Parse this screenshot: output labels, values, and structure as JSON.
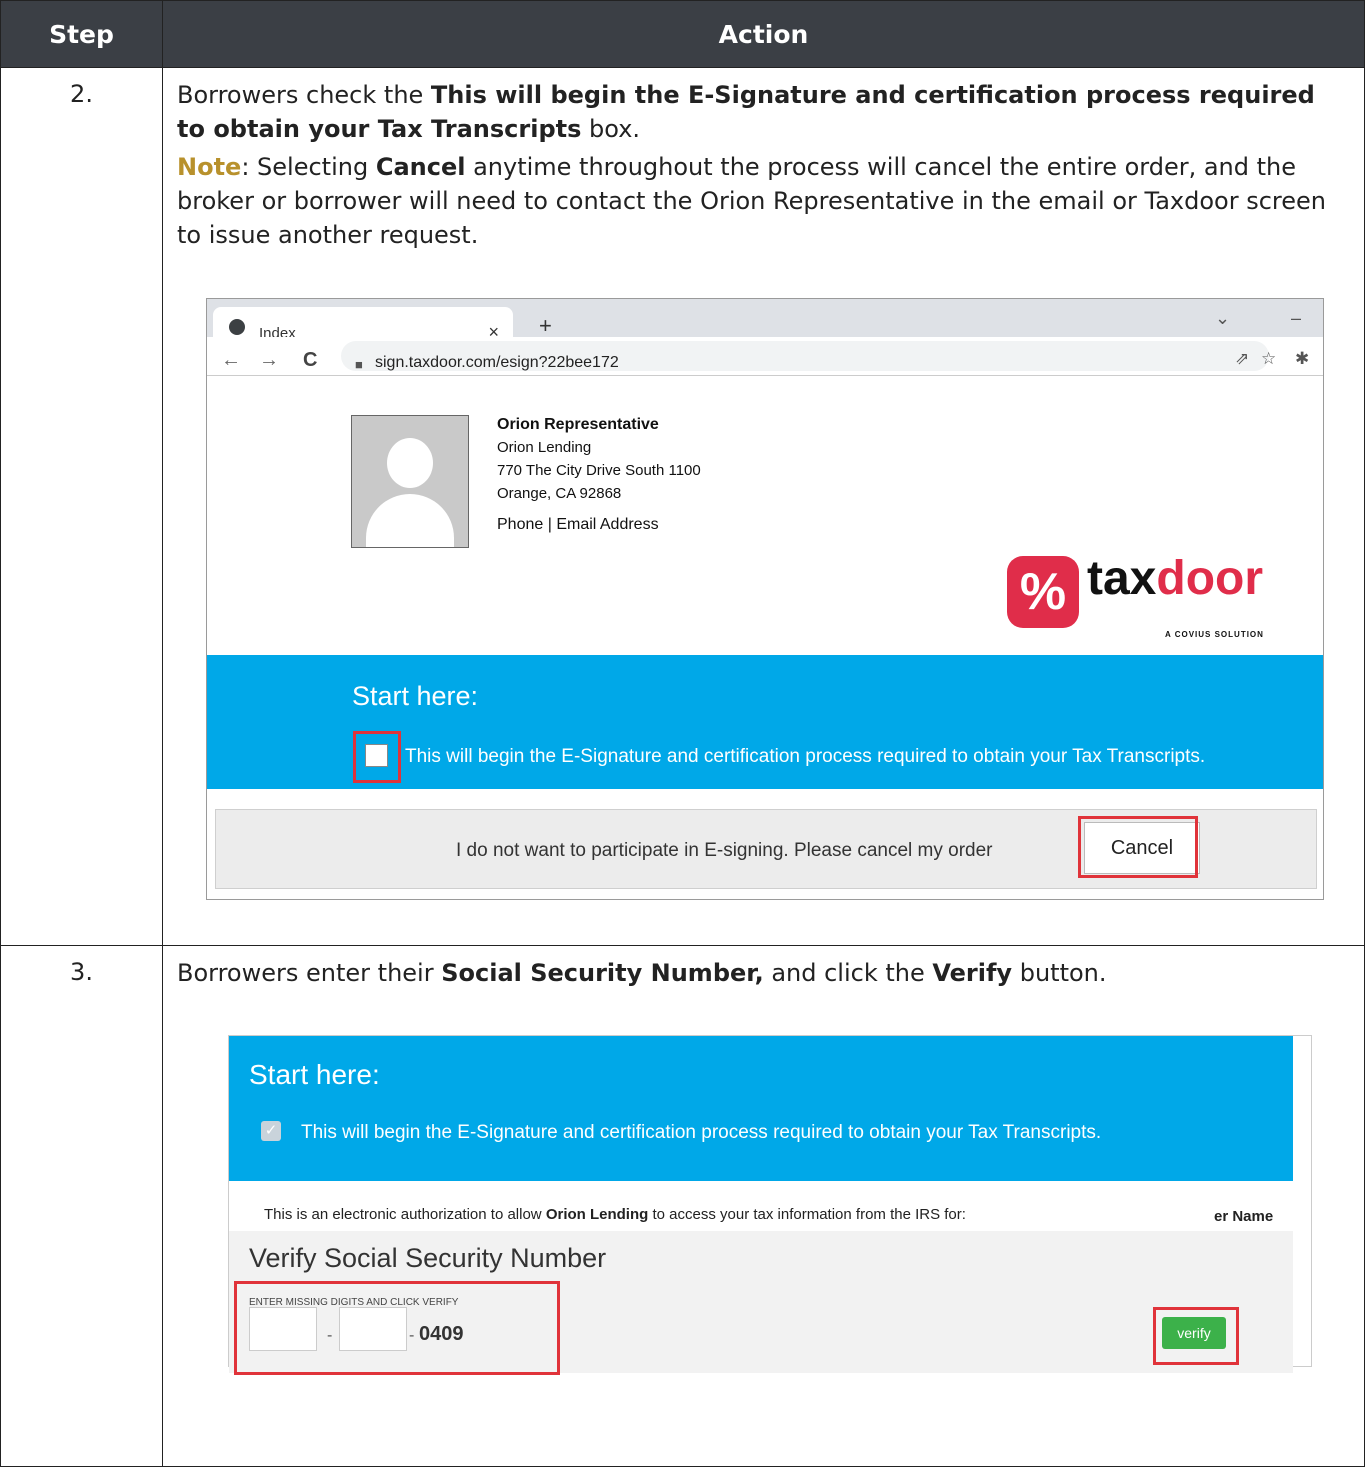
{
  "table": {
    "headers": [
      "Step",
      "Action"
    ]
  },
  "step2": {
    "number": "2.",
    "line_pre": "Borrowers check the ",
    "line_bold": "This will begin the E-Signature and certification process required to obtain your Tax Transcripts",
    "line_post": " box.",
    "note_label": "Note",
    "note_pre": ": Selecting ",
    "note_bold": "Cancel",
    "note_post": " anytime throughout the process will cancel the entire order, and the broker or borrower will need to contact the Orion Representative in the email or Taxdoor screen to issue another request.",
    "browser": {
      "tab_title": "Index",
      "tab_close": "×",
      "new_tab": "+",
      "win_chevron": "⌄",
      "win_min": "–",
      "back": "←",
      "forward": "→",
      "reload": "C",
      "url": "sign.taxdoor.com/esign?22bee172",
      "share_icon": "⇗",
      "star_icon": "☆",
      "ext_icon": "✱"
    },
    "contact": {
      "name": "Orion Representative",
      "company": "Orion Lending",
      "address1": "770 The City Drive South 1100",
      "address2": "Orange, CA 92868",
      "links": "Phone | Email Address"
    },
    "logo": {
      "mark": "%",
      "word_a": "tax",
      "word_b": "door",
      "tagline": "A COVIUS SOLUTION"
    },
    "start_title": "Start here:",
    "checkbox_text": "This will begin the E-Signature and certification process required to obtain your Tax Transcripts.",
    "cancel_message": "I do not want to participate in E-signing. Please cancel my order",
    "cancel_button": "Cancel"
  },
  "step3": {
    "number": "3.",
    "line_pre": "Borrowers enter their ",
    "line_bold1": "Social Security Number,",
    "line_mid": " and click the ",
    "line_bold2": "Verify",
    "line_post": " button.",
    "start_title": "Start here:",
    "checkbox_mark": "✓",
    "checkbox_text": "This will begin the E-Signature and certification process required to obtain your Tax Transcripts.",
    "auth_pre": "This is an electronic authorization to allow ",
    "auth_bold": "Orion Lending",
    "auth_post": " to access your tax information from the IRS for:",
    "auth_right": "er Name",
    "verify_title": "Verify Social Security Number",
    "digits_label": "ENTER MISSING DIGITS AND CLICK VERIFY",
    "dash": "-",
    "last_digits": "0409",
    "verify_button": "verify"
  }
}
